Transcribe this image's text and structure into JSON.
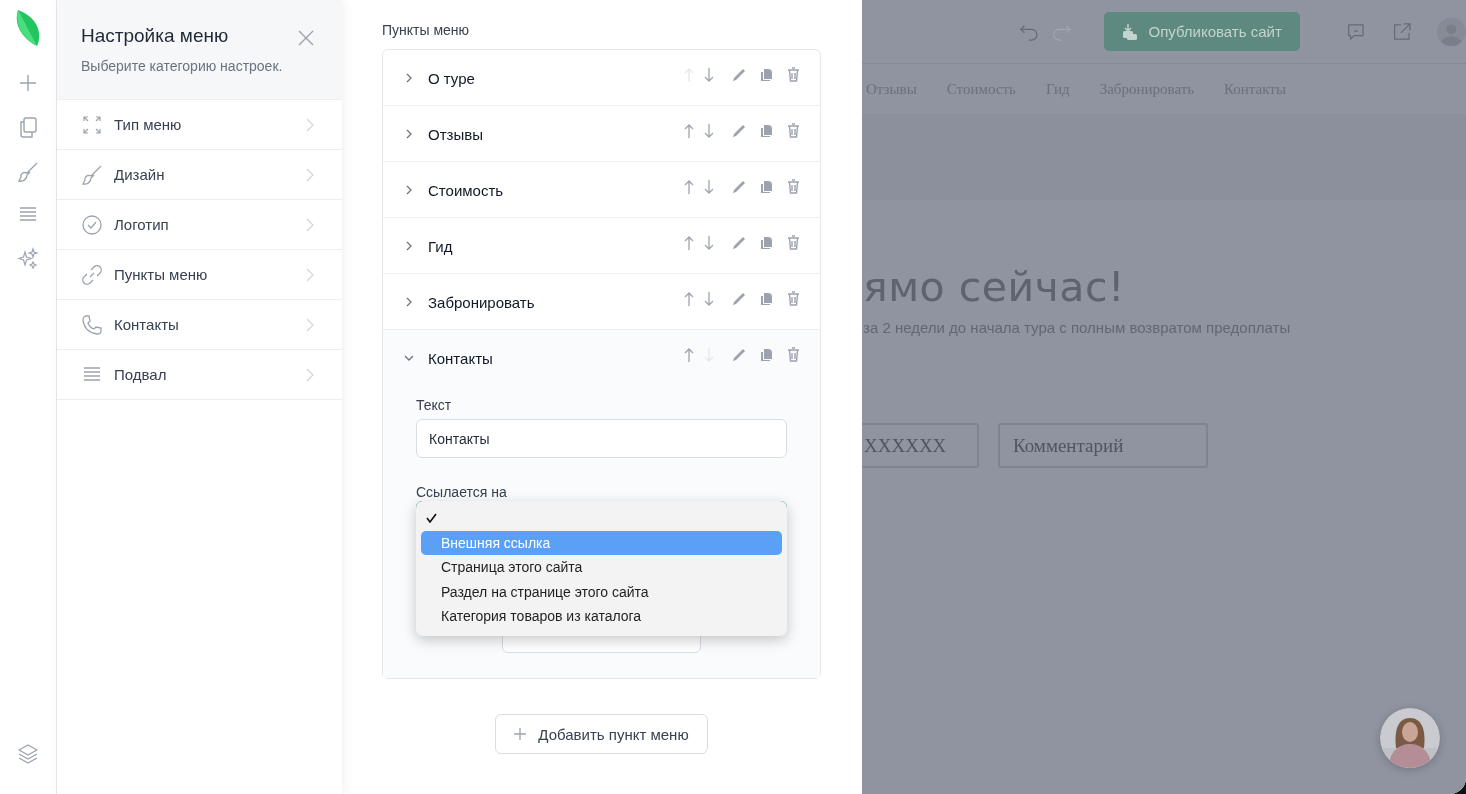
{
  "settings": {
    "title": "Настройка меню",
    "subtitle": "Выберите категорию настроек.",
    "categories": [
      {
        "label": "Тип меню"
      },
      {
        "label": "Дизайн"
      },
      {
        "label": "Логотип"
      },
      {
        "label": "Пункты меню"
      },
      {
        "label": "Контакты"
      },
      {
        "label": "Подвал"
      }
    ]
  },
  "editor": {
    "heading": "Пункты меню",
    "items": [
      {
        "label": "О туре",
        "expanded": false,
        "up_disabled": true,
        "down_disabled": false
      },
      {
        "label": "Отзывы",
        "expanded": false,
        "up_disabled": false,
        "down_disabled": false
      },
      {
        "label": "Стоимость",
        "expanded": false,
        "up_disabled": false,
        "down_disabled": false
      },
      {
        "label": "Гид",
        "expanded": false,
        "up_disabled": false,
        "down_disabled": false
      },
      {
        "label": "Забронировать",
        "expanded": false,
        "up_disabled": false,
        "down_disabled": false
      },
      {
        "label": "Контакты",
        "expanded": true,
        "up_disabled": false,
        "down_disabled": true,
        "detail": {
          "text_label": "Текст",
          "text_value": "Контакты",
          "link_label": "Ссылается на",
          "link_options": [
            {
              "checked": true,
              "selected": false
            },
            {
              "label": "Внешняя ссылка",
              "checked": false,
              "selected": true
            },
            {
              "label": "Страница этого сайта",
              "checked": false,
              "selected": false
            },
            {
              "label": "Раздел на странице этого сайта",
              "checked": false,
              "selected": false
            },
            {
              "label": "Категория товаров из каталога",
              "checked": false,
              "selected": false
            }
          ]
        }
      }
    ],
    "add_item": "Добавить пункт меню"
  },
  "preview": {
    "undo": {
      "disabled": false
    },
    "redo": {
      "disabled": true
    },
    "publish": "Опубликовать сайт",
    "nav": [
      "Отзывы",
      "Стоимость",
      "Гид",
      "Забронировать",
      "Контакты"
    ],
    "heading": "ямо сейчас!",
    "subtitle": "за 2 недели до начала тура с полным возвратом предоплаты",
    "fields": [
      {
        "placeholder": "XXXXXX"
      },
      {
        "placeholder": "Комментарий"
      }
    ]
  }
}
